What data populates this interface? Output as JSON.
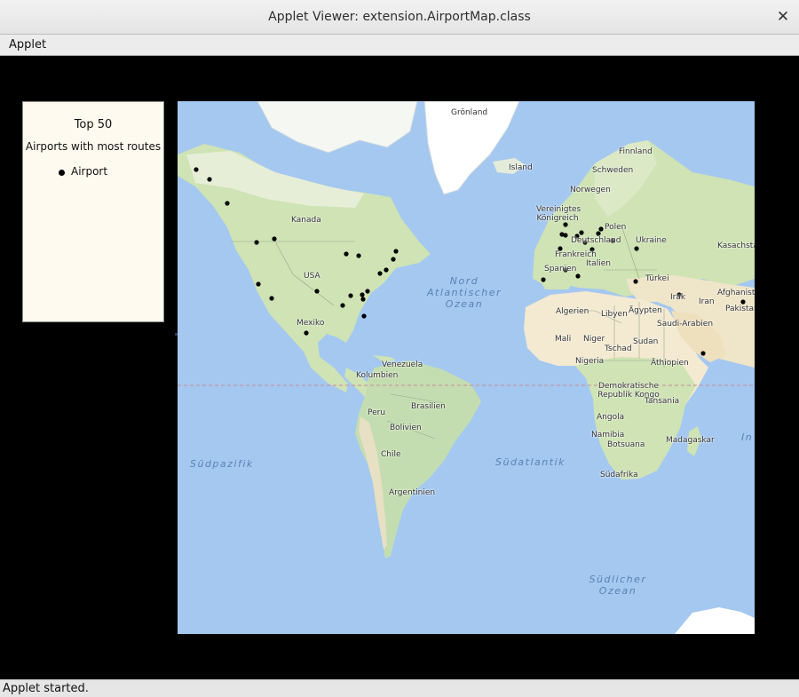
{
  "window": {
    "title": "Applet Viewer: extension.AirportMap.class",
    "close_icon": "close-icon",
    "close_glyph": "✕"
  },
  "menu": {
    "applet_label": "Applet"
  },
  "legend": {
    "title": "Top 50",
    "subtitle": "Airports with most routes",
    "item_label": "Airport"
  },
  "map": {
    "labels": {
      "gronland": "Grönland",
      "island": "Island",
      "finnland": "Finnland",
      "schweden": "Schweden",
      "norwegen": "Norwegen",
      "vk": "Vereinigtes Königreich",
      "polen": "Polen",
      "deutschland": "Deutschland",
      "ukraine": "Ukraine",
      "kasachstan": "Kasachsta",
      "frankreich": "Frankreich",
      "italien": "Italien",
      "spanien": "Spanien",
      "turkei": "Türkei",
      "kanada": "Kanada",
      "usa": "USA",
      "mexiko": "Mexiko",
      "nord_atlantik": "Nord Atlantischer Ozean",
      "algerien": "Algerien",
      "libyen": "Libyen",
      "agypten": "Ägypten",
      "irak": "Irak",
      "iran": "Iran",
      "afghanistan": "Afghanista",
      "pakistan": "Pakistan",
      "saudi": "Saudi-Arabien",
      "mali": "Mali",
      "niger": "Niger",
      "tschad": "Tschad",
      "sudan": "Sudan",
      "nigeria": "Nigeria",
      "athiopien": "Äthiopien",
      "venezuela": "Venezuela",
      "kolumbien": "Kolumbien",
      "peru": "Peru",
      "brasilien": "Brasilien",
      "bolivien": "Bolivien",
      "chile": "Chile",
      "argentinien": "Argentinien",
      "kongo": "Demokratische Republik Kongo",
      "tansania": "Tansania",
      "angola": "Angola",
      "namibia": "Namibia",
      "botsuana": "Botsuana",
      "madagaskar": "Madagaskar",
      "sudafrika": "Südafrika",
      "sudpazifik": "Südpazifik",
      "sudatlantik": "Südatlantik",
      "sudlicher_ozean": "Südlicher Ozean",
      "in": "In"
    }
  },
  "colors": {
    "ocean": "#a4c8f0",
    "land": "#cfe3b4",
    "desert": "#f3ead1",
    "ice": "#ffffff",
    "marker": "#000000",
    "legend_bg": "#fffaf0"
  },
  "status": {
    "text": "Applet started."
  }
}
